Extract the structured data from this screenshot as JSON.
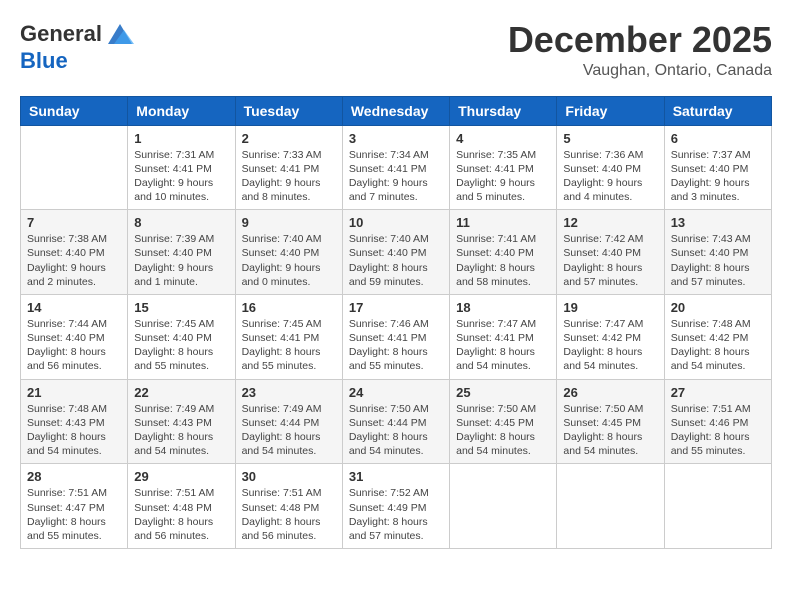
{
  "header": {
    "logo_general": "General",
    "logo_blue": "Blue",
    "month": "December 2025",
    "location": "Vaughan, Ontario, Canada"
  },
  "days": [
    "Sunday",
    "Monday",
    "Tuesday",
    "Wednesday",
    "Thursday",
    "Friday",
    "Saturday"
  ],
  "weeks": [
    [
      {
        "date": "",
        "info": ""
      },
      {
        "date": "1",
        "info": "Sunrise: 7:31 AM\nSunset: 4:41 PM\nDaylight: 9 hours\nand 10 minutes."
      },
      {
        "date": "2",
        "info": "Sunrise: 7:33 AM\nSunset: 4:41 PM\nDaylight: 9 hours\nand 8 minutes."
      },
      {
        "date": "3",
        "info": "Sunrise: 7:34 AM\nSunset: 4:41 PM\nDaylight: 9 hours\nand 7 minutes."
      },
      {
        "date": "4",
        "info": "Sunrise: 7:35 AM\nSunset: 4:41 PM\nDaylight: 9 hours\nand 5 minutes."
      },
      {
        "date": "5",
        "info": "Sunrise: 7:36 AM\nSunset: 4:40 PM\nDaylight: 9 hours\nand 4 minutes."
      },
      {
        "date": "6",
        "info": "Sunrise: 7:37 AM\nSunset: 4:40 PM\nDaylight: 9 hours\nand 3 minutes."
      }
    ],
    [
      {
        "date": "7",
        "info": "Sunrise: 7:38 AM\nSunset: 4:40 PM\nDaylight: 9 hours\nand 2 minutes."
      },
      {
        "date": "8",
        "info": "Sunrise: 7:39 AM\nSunset: 4:40 PM\nDaylight: 9 hours\nand 1 minute."
      },
      {
        "date": "9",
        "info": "Sunrise: 7:40 AM\nSunset: 4:40 PM\nDaylight: 9 hours\nand 0 minutes."
      },
      {
        "date": "10",
        "info": "Sunrise: 7:40 AM\nSunset: 4:40 PM\nDaylight: 8 hours\nand 59 minutes."
      },
      {
        "date": "11",
        "info": "Sunrise: 7:41 AM\nSunset: 4:40 PM\nDaylight: 8 hours\nand 58 minutes."
      },
      {
        "date": "12",
        "info": "Sunrise: 7:42 AM\nSunset: 4:40 PM\nDaylight: 8 hours\nand 57 minutes."
      },
      {
        "date": "13",
        "info": "Sunrise: 7:43 AM\nSunset: 4:40 PM\nDaylight: 8 hours\nand 57 minutes."
      }
    ],
    [
      {
        "date": "14",
        "info": "Sunrise: 7:44 AM\nSunset: 4:40 PM\nDaylight: 8 hours\nand 56 minutes."
      },
      {
        "date": "15",
        "info": "Sunrise: 7:45 AM\nSunset: 4:40 PM\nDaylight: 8 hours\nand 55 minutes."
      },
      {
        "date": "16",
        "info": "Sunrise: 7:45 AM\nSunset: 4:41 PM\nDaylight: 8 hours\nand 55 minutes."
      },
      {
        "date": "17",
        "info": "Sunrise: 7:46 AM\nSunset: 4:41 PM\nDaylight: 8 hours\nand 55 minutes."
      },
      {
        "date": "18",
        "info": "Sunrise: 7:47 AM\nSunset: 4:41 PM\nDaylight: 8 hours\nand 54 minutes."
      },
      {
        "date": "19",
        "info": "Sunrise: 7:47 AM\nSunset: 4:42 PM\nDaylight: 8 hours\nand 54 minutes."
      },
      {
        "date": "20",
        "info": "Sunrise: 7:48 AM\nSunset: 4:42 PM\nDaylight: 8 hours\nand 54 minutes."
      }
    ],
    [
      {
        "date": "21",
        "info": "Sunrise: 7:48 AM\nSunset: 4:43 PM\nDaylight: 8 hours\nand 54 minutes."
      },
      {
        "date": "22",
        "info": "Sunrise: 7:49 AM\nSunset: 4:43 PM\nDaylight: 8 hours\nand 54 minutes."
      },
      {
        "date": "23",
        "info": "Sunrise: 7:49 AM\nSunset: 4:44 PM\nDaylight: 8 hours\nand 54 minutes."
      },
      {
        "date": "24",
        "info": "Sunrise: 7:50 AM\nSunset: 4:44 PM\nDaylight: 8 hours\nand 54 minutes."
      },
      {
        "date": "25",
        "info": "Sunrise: 7:50 AM\nSunset: 4:45 PM\nDaylight: 8 hours\nand 54 minutes."
      },
      {
        "date": "26",
        "info": "Sunrise: 7:50 AM\nSunset: 4:45 PM\nDaylight: 8 hours\nand 54 minutes."
      },
      {
        "date": "27",
        "info": "Sunrise: 7:51 AM\nSunset: 4:46 PM\nDaylight: 8 hours\nand 55 minutes."
      }
    ],
    [
      {
        "date": "28",
        "info": "Sunrise: 7:51 AM\nSunset: 4:47 PM\nDaylight: 8 hours\nand 55 minutes."
      },
      {
        "date": "29",
        "info": "Sunrise: 7:51 AM\nSunset: 4:48 PM\nDaylight: 8 hours\nand 56 minutes."
      },
      {
        "date": "30",
        "info": "Sunrise: 7:51 AM\nSunset: 4:48 PM\nDaylight: 8 hours\nand 56 minutes."
      },
      {
        "date": "31",
        "info": "Sunrise: 7:52 AM\nSunset: 4:49 PM\nDaylight: 8 hours\nand 57 minutes."
      },
      {
        "date": "",
        "info": ""
      },
      {
        "date": "",
        "info": ""
      },
      {
        "date": "",
        "info": ""
      }
    ]
  ]
}
